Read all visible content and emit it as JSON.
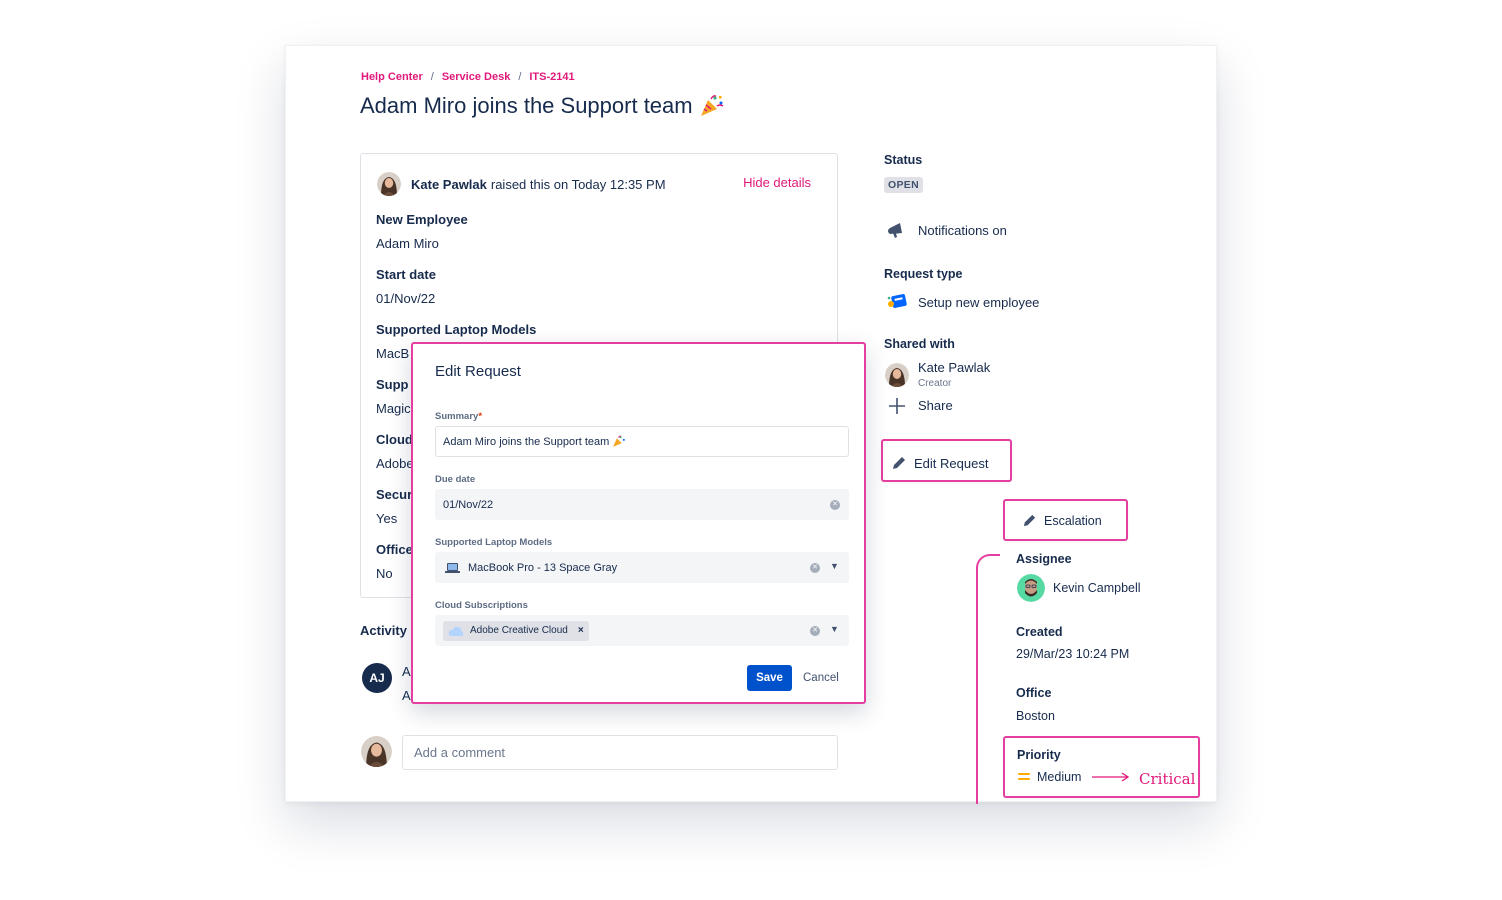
{
  "breadcrumb": [
    "Help Center",
    "Service Desk",
    "ITS-2141"
  ],
  "breadcrumb_separator": "/",
  "title": "Adam Miro joins the Support team",
  "details": {
    "reporter": "Kate Pawlak",
    "raised_text": "raised this on Today 12:35 PM",
    "hide_details": "Hide details",
    "fields": [
      {
        "label": "New Employee",
        "value": "Adam Miro"
      },
      {
        "label": "Start date",
        "value": "01/Nov/22"
      },
      {
        "label": "Supported Laptop Models",
        "value": "MacB"
      },
      {
        "label": "Supp",
        "value": "Magic"
      },
      {
        "label": "Cloud",
        "value": "Adobe"
      },
      {
        "label": "Secur",
        "value": "Yes"
      },
      {
        "label": "Office",
        "value": "No"
      }
    ]
  },
  "activity": {
    "title": "Activity",
    "avatar_initials": "AJ",
    "line1": "A",
    "line2": "A",
    "comment_placeholder": "Add a comment"
  },
  "sidebar": {
    "status_label": "Status",
    "status_value": "OPEN",
    "notifications": "Notifications on",
    "request_type_label": "Request type",
    "request_type": "Setup new employee",
    "shared_with_label": "Shared with",
    "shared_name": "Kate Pawlak",
    "shared_role": "Creator",
    "share": "Share",
    "edit_request": "Edit Request",
    "escalation": "Escalation",
    "assignee_label": "Assignee",
    "assignee": "Kevin Campbell",
    "created_label": "Created",
    "created": "29/Mar/23 10:24 PM",
    "office_label": "Office",
    "office": "Boston",
    "priority_label": "Priority",
    "priority_from": "Medium",
    "priority_to": "Critical"
  },
  "modal": {
    "title": "Edit Request",
    "summary_label": "Summary",
    "summary_required": "*",
    "summary_value": "Adam Miro joins the Support team",
    "due_label": "Due date",
    "due_value": "01/Nov/22",
    "laptop_label": "Supported Laptop Models",
    "laptop_value": "MacBook Pro - 13 Space Gray",
    "cloud_label": "Cloud Subscriptions",
    "cloud_chip": "Adobe Creative Cloud",
    "save": "Save",
    "cancel": "Cancel"
  },
  "colors": {
    "accent_pink": "#e43fa0",
    "link_pink": "#e0197a",
    "primary_blue": "#0052cc",
    "text_dark": "#172b4d",
    "priority_medium": "#ffab00"
  }
}
